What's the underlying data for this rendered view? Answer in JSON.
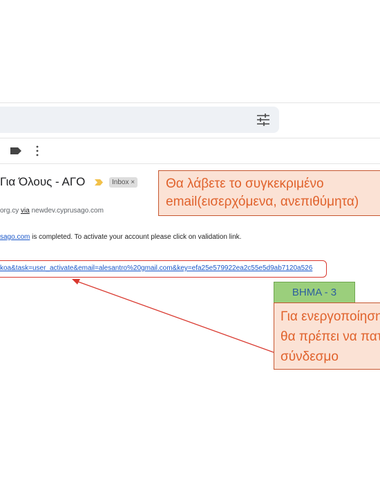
{
  "email": {
    "subject": "Για Όλους - ΑΓΟ",
    "inbox_badge": "Inbox ×",
    "sender_prefix": "org.cy ",
    "sender_via": "via",
    "sender_domain": " newdev.cyprusago.com",
    "body_link": "sago.com",
    "body_text": " is completed. To activate your account please click on validation link.",
    "activation_link": "koa&task=user_activate&email=alesantro%20gmail.com&key=efa25e579922ea2c55e5d9ab7120a526"
  },
  "annotations": {
    "top_callout": {
      "line1": "Θα λάβετε το συγκεκριμένο",
      "line2": "email(εισερχόμενα, ανεπιθύμητα)"
    },
    "step_label": "ΒΗΜΑ - 3",
    "bottom_callout": {
      "line1": "Για ενεργοποίηση",
      "line2": "θα πρέπει να πατήσετε",
      "line3": "σύνδεσμο"
    }
  },
  "icons": {
    "search_options": "tune-icon",
    "label": "label-icon",
    "more": "more-vert-icon",
    "important": "important-marker-icon"
  },
  "colors": {
    "callout_fill": "#fbe2d5",
    "callout_text": "#e0622c",
    "step_fill": "#9bcf7c",
    "step_text": "#2e5f9e",
    "arrow": "#d9382e",
    "link": "#1a57c9"
  }
}
